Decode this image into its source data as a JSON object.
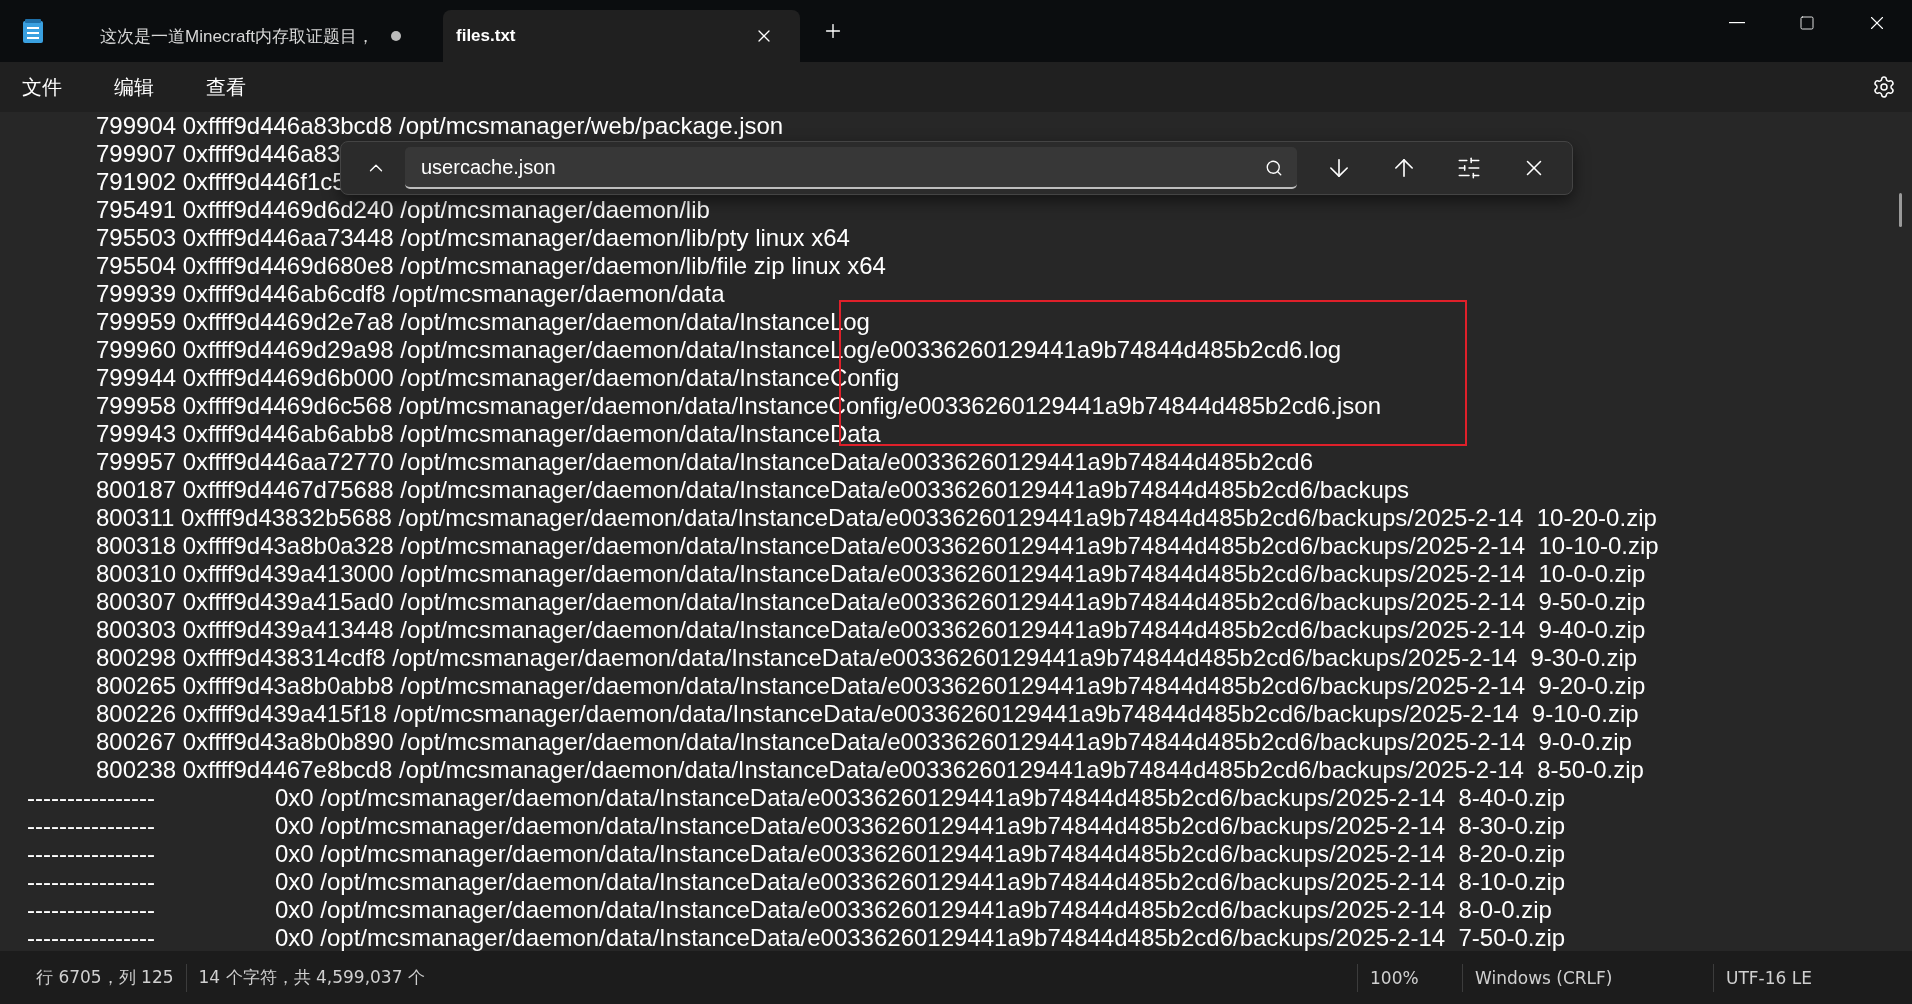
{
  "tabs": [
    {
      "title": "这次是一道Minecraft内存取证题目，",
      "selected": false,
      "unsaved": true
    },
    {
      "title": "files.txt",
      "selected": true,
      "unsaved": false
    }
  ],
  "menu": [
    "文件",
    "编辑",
    "查看"
  ],
  "lines": [
    {
      "kind": "entry",
      "text": "799904 0xffff9d446a83bcd8 /opt/mcsmanager/web/package.json"
    },
    {
      "kind": "entry",
      "text": "799907 0xffff9d446a83"
    },
    {
      "kind": "entry",
      "text": "791902 0xffff9d446f1c5"
    },
    {
      "kind": "entry",
      "text": "795491 0xffff9d4469d6d240 /opt/mcsmanager/daemon/lib"
    },
    {
      "kind": "entry",
      "text": "795503 0xffff9d446aa73448 /opt/mcsmanager/daemon/lib/pty linux x64"
    },
    {
      "kind": "entry",
      "text": "795504 0xffff9d4469d680e8 /opt/mcsmanager/daemon/lib/file zip linux x64"
    },
    {
      "kind": "entry",
      "text": "799939 0xffff9d446ab6cdf8 /opt/mcsmanager/daemon/data"
    },
    {
      "kind": "entry",
      "text": "799959 0xffff9d4469d2e7a8 /opt/mcsmanager/daemon/data/InstanceLog"
    },
    {
      "kind": "entry",
      "text": "799960 0xffff9d4469d29a98 /opt/mcsmanager/daemon/data/InstanceLog/e00336260129441a9b74844d485b2cd6.log"
    },
    {
      "kind": "entry",
      "text": "799944 0xffff9d4469d6b000 /opt/mcsmanager/daemon/data/InstanceConfig"
    },
    {
      "kind": "entry",
      "text": "799958 0xffff9d4469d6c568 /opt/mcsmanager/daemon/data/InstanceConfig/e00336260129441a9b74844d485b2cd6.json"
    },
    {
      "kind": "entry",
      "text": "799943 0xffff9d446ab6abb8 /opt/mcsmanager/daemon/data/InstanceData"
    },
    {
      "kind": "entry",
      "text": "799957 0xffff9d446aa72770 /opt/mcsmanager/daemon/data/InstanceData/e00336260129441a9b74844d485b2cd6"
    },
    {
      "kind": "entry",
      "text": "800187 0xffff9d4467d75688 /opt/mcsmanager/daemon/data/InstanceData/e00336260129441a9b74844d485b2cd6/backups"
    },
    {
      "kind": "entry",
      "text": "800311 0xffff9d43832b5688 /opt/mcsmanager/daemon/data/InstanceData/e00336260129441a9b74844d485b2cd6/backups/2025-2-14  10-20-0.zip"
    },
    {
      "kind": "entry",
      "text": "800318 0xffff9d43a8b0a328 /opt/mcsmanager/daemon/data/InstanceData/e00336260129441a9b74844d485b2cd6/backups/2025-2-14  10-10-0.zip"
    },
    {
      "kind": "entry",
      "text": "800310 0xffff9d439a413000 /opt/mcsmanager/daemon/data/InstanceData/e00336260129441a9b74844d485b2cd6/backups/2025-2-14  10-0-0.zip"
    },
    {
      "kind": "entry",
      "text": "800307 0xffff9d439a415ad0 /opt/mcsmanager/daemon/data/InstanceData/e00336260129441a9b74844d485b2cd6/backups/2025-2-14  9-50-0.zip"
    },
    {
      "kind": "entry",
      "text": "800303 0xffff9d439a413448 /opt/mcsmanager/daemon/data/InstanceData/e00336260129441a9b74844d485b2cd6/backups/2025-2-14  9-40-0.zip"
    },
    {
      "kind": "entry",
      "text": "800298 0xffff9d438314cdf8 /opt/mcsmanager/daemon/data/InstanceData/e00336260129441a9b74844d485b2cd6/backups/2025-2-14  9-30-0.zip"
    },
    {
      "kind": "entry",
      "text": "800265 0xffff9d43a8b0abb8 /opt/mcsmanager/daemon/data/InstanceData/e00336260129441a9b74844d485b2cd6/backups/2025-2-14  9-20-0.zip"
    },
    {
      "kind": "entry",
      "text": "800226 0xffff9d439a415f18 /opt/mcsmanager/daemon/data/InstanceData/e00336260129441a9b74844d485b2cd6/backups/2025-2-14  9-10-0.zip"
    },
    {
      "kind": "entry",
      "text": "800267 0xffff9d43a8b0b890 /opt/mcsmanager/daemon/data/InstanceData/e00336260129441a9b74844d485b2cd6/backups/2025-2-14  9-0-0.zip"
    },
    {
      "kind": "entry",
      "text": "800238 0xffff9d4467e8bcd8 /opt/mcsmanager/daemon/data/InstanceData/e00336260129441a9b74844d485b2cd6/backups/2025-2-14  8-50-0.zip"
    },
    {
      "kind": "orphan",
      "text": "----------------                  0x0 /opt/mcsmanager/daemon/data/InstanceData/e00336260129441a9b74844d485b2cd6/backups/2025-2-14  8-40-0.zip"
    },
    {
      "kind": "orphan",
      "text": "----------------                  0x0 /opt/mcsmanager/daemon/data/InstanceData/e00336260129441a9b74844d485b2cd6/backups/2025-2-14  8-30-0.zip"
    },
    {
      "kind": "orphan",
      "text": "----------------                  0x0 /opt/mcsmanager/daemon/data/InstanceData/e00336260129441a9b74844d485b2cd6/backups/2025-2-14  8-20-0.zip"
    },
    {
      "kind": "orphan",
      "text": "----------------                  0x0 /opt/mcsmanager/daemon/data/InstanceData/e00336260129441a9b74844d485b2cd6/backups/2025-2-14  8-10-0.zip"
    },
    {
      "kind": "orphan",
      "text": "----------------                  0x0 /opt/mcsmanager/daemon/data/InstanceData/e00336260129441a9b74844d485b2cd6/backups/2025-2-14  8-0-0.zip"
    },
    {
      "kind": "orphan",
      "text": "----------------                  0x0 /opt/mcsmanager/daemon/data/InstanceData/e00336260129441a9b74844d485b2cd6/backups/2025-2-14  7-50-0.zip"
    }
  ],
  "find": {
    "value": "usercache.json"
  },
  "status_bar": {
    "position": "行 6705，列 125",
    "selection": "14 个字符，共 4,599,037 个",
    "zoom": "100%",
    "line_ending": "Windows (CRLF)",
    "encoding": "UTF-16 LE"
  }
}
